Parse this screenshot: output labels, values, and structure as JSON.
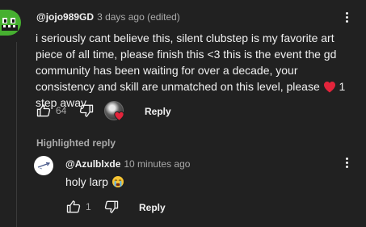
{
  "comment": {
    "author": "@jojo989GD",
    "meta": "3 days ago (edited)",
    "body_before_heart": "i seriously cant believe this, silent clubstep is my favorite art piece of all time, please finish this <3 this is the event the gd community has been waiting for over a decade, your consistency and skill are unmatched on this level, please",
    "body_after_heart": "1 step away",
    "like_count": "64",
    "reply_label": "Reply"
  },
  "highlighted": {
    "label": "Highlighted reply"
  },
  "reply": {
    "author": "@Azulblxde",
    "meta": "10 minutes ago",
    "body": "holy larp",
    "like_count": "1",
    "reply_label": "Reply"
  },
  "colors": {
    "background": "#212121",
    "text_primary": "#f1f1f1",
    "text_secondary": "#aaaaaa",
    "avatar_green": "#46b030",
    "heart_red": "#e3243b"
  },
  "icons": {
    "main_avatar": "green-monster-avatar",
    "reply_avatar": "white-sketch-avatar",
    "like": "thumbs-up-outline",
    "dislike": "thumbs-down-outline",
    "creator_heart": "creator-heart-badge",
    "more": "vertical-ellipsis",
    "inline_heart": "red-heart-emoji",
    "reply_emoji": "crying-face-emoji"
  }
}
